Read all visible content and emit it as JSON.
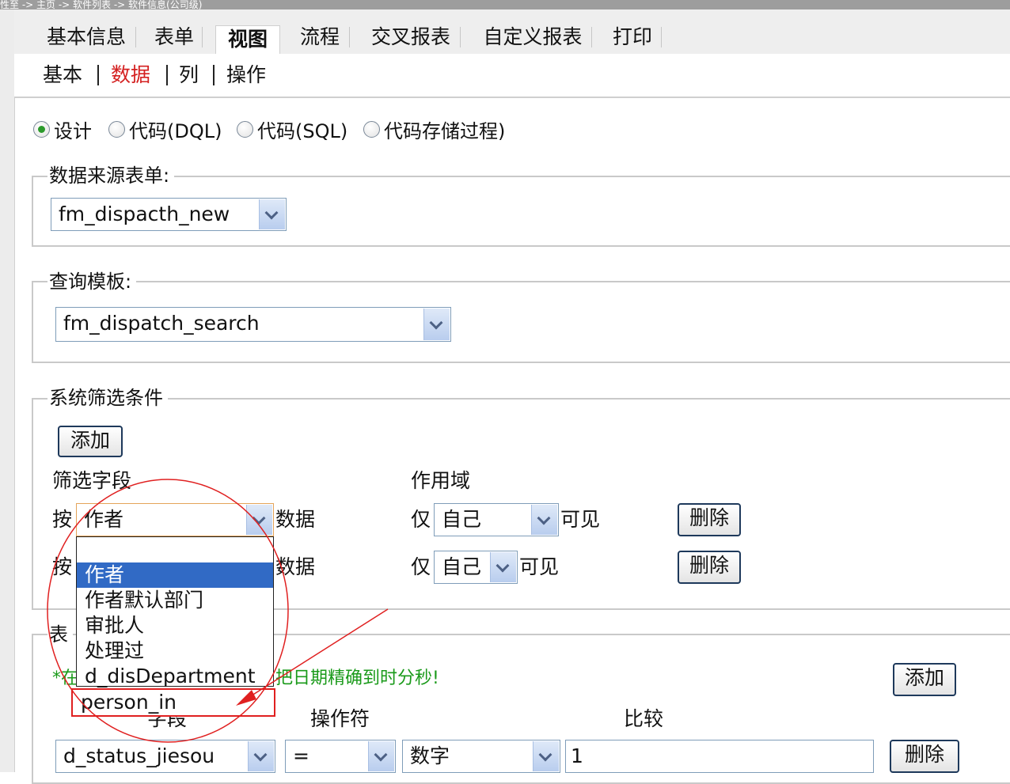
{
  "window": {
    "title": "性至 -> 主页 -> 软件列表 -> 软件信息(公司级)"
  },
  "tabs": [
    {
      "label": "基本信息",
      "active": false
    },
    {
      "label": "表单",
      "active": false
    },
    {
      "label": "视图",
      "active": true
    },
    {
      "label": "流程",
      "active": false
    },
    {
      "label": "交叉报表",
      "active": false
    },
    {
      "label": "自定义报表",
      "active": false
    },
    {
      "label": "打印",
      "active": false
    }
  ],
  "subtabs": [
    {
      "label": "基本",
      "active": false
    },
    {
      "label": "数据",
      "active": true
    },
    {
      "label": "列",
      "active": false
    },
    {
      "label": "操作",
      "active": false
    }
  ],
  "mode_radios": [
    {
      "label": "设计",
      "checked": true
    },
    {
      "label": "代码(DQL)",
      "checked": false
    },
    {
      "label": "代码(SQL)",
      "checked": false
    },
    {
      "label": "代码存储过程)",
      "checked": false
    }
  ],
  "data_source": {
    "legend": "数据来源表单:",
    "selected": "fm_dispacth_new"
  },
  "query_template": {
    "legend": "查询模板:",
    "selected": "fm_dispatch_search"
  },
  "system_filter": {
    "legend": "系统筛选条件",
    "add_label": "添加",
    "col_field": "筛选字段",
    "col_scope": "作用域",
    "rows": [
      {
        "prefix": "按",
        "field": "作者",
        "suffix": "数据",
        "scope_prefix": "仅",
        "scope": "自己",
        "scope_suffix": "可见",
        "delete_label": "删除"
      },
      {
        "prefix": "按",
        "field": "",
        "suffix": "数据",
        "scope_prefix": "仅",
        "scope": "自己",
        "scope_suffix": "可见",
        "delete_label": "删除"
      }
    ],
    "dropdown_options": [
      "",
      "作者",
      "作者默认部门",
      "审批人",
      "处理过",
      "d_disDepartment",
      "person_in"
    ],
    "dropdown_selected_index": 1
  },
  "form_filter": {
    "legend_partial": "表",
    "note_prefix": "*在",
    "note_suffix": "把日期精确到时分秒!",
    "add_label": "添加",
    "col_field": "字段",
    "col_operator": "操作符",
    "col_compare": "比较",
    "row": {
      "field": "d_status_jiesou",
      "operator": "=",
      "type": "数字",
      "value": "1",
      "delete_label": "删除"
    }
  },
  "colors": {
    "annotation": "#e02020",
    "selection": "#316ac5",
    "active_subtab": "#d42020",
    "note_green": "#1a9a1a"
  }
}
